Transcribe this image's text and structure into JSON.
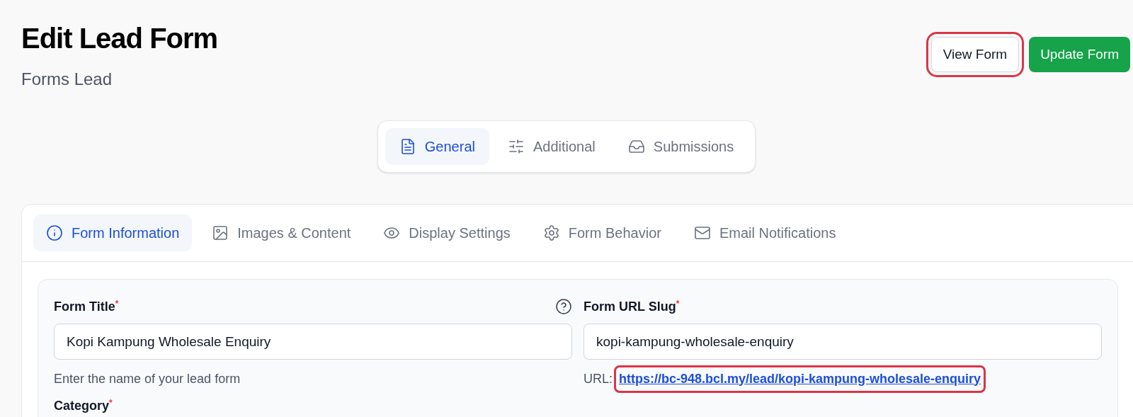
{
  "header": {
    "title": "Edit Lead Form",
    "subtitle": "Forms Lead"
  },
  "actions": [
    {
      "kind": "secondary",
      "label": "View Form",
      "highlighted": true
    },
    {
      "kind": "primary",
      "label": "Update Form",
      "highlighted": false
    }
  ],
  "main_tabs": [
    {
      "label": "General",
      "selected": true
    },
    {
      "label": "Additional",
      "selected": false
    },
    {
      "label": "Submissions",
      "selected": false
    }
  ],
  "sub_tabs": [
    {
      "label": "Form Information",
      "selected": true
    },
    {
      "label": "Images & Content",
      "selected": false
    },
    {
      "label": "Display Settings",
      "selected": false
    },
    {
      "label": "Form Behavior",
      "selected": false
    },
    {
      "label": "Email Notifications",
      "selected": false
    }
  ],
  "fields": [
    {
      "label": "Form Title",
      "required_mark": "*",
      "help": true,
      "value": "Kopi Kampung Wholesale Enquiry",
      "hint": "Enter the name of your lead form"
    },
    {
      "label": "Form URL Slug",
      "required_mark": "*",
      "value": "kopi-kampung-wholesale-enquiry",
      "url_prefix": "URL:",
      "url": "https://bc-948.bcl.my/lead/kopi-kampung-wholesale-enquiry",
      "url_highlighted": true
    }
  ],
  "next_field": {
    "label": "Category",
    "required_mark": "*"
  }
}
